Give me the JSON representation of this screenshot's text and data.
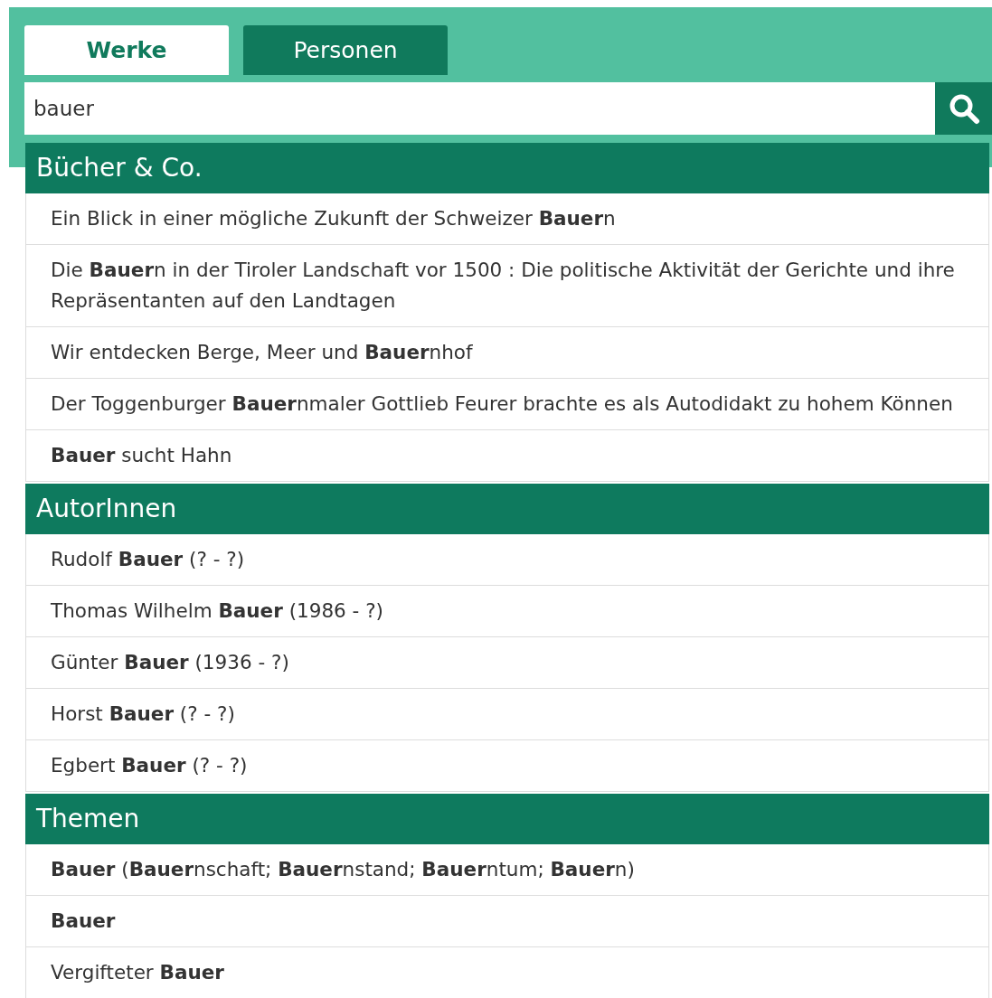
{
  "tabs": [
    {
      "label": "Werke",
      "selected": true
    },
    {
      "label": "Personen",
      "selected": false
    }
  ],
  "search": {
    "value": "bauer"
  },
  "sections": [
    {
      "title": "Bücher & Co.",
      "items": [
        "Ein Blick in einer mögliche Zukunft der Schweizer **Bauer**n",
        "Die **Bauer**n in der Tiroler Landschaft vor 1500 : Die politische Aktivität der Gerichte und ihre Repräsentanten auf den Landtagen",
        "Wir entdecken Berge, Meer und **Bauer**nhof",
        "Der Toggenburger **Bauer**nmaler Gottlieb Feurer brachte es als Autodidakt zu hohem Können",
        "**Bauer** sucht Hahn"
      ]
    },
    {
      "title": "AutorInnen",
      "items": [
        "Rudolf **Bauer** (? - ?)",
        "Thomas Wilhelm **Bauer** (1986 - ?)",
        "Günter **Bauer** (1936 - ?)",
        "Horst **Bauer** (? - ?)",
        "Egbert **Bauer** (? - ?)"
      ]
    },
    {
      "title": "Themen",
      "items": [
        "**Bauer** (**Bauer**nschaft; **Bauer**nstand; **Bauer**ntum; **Bauer**n)",
        "**Bauer**",
        "Vergifteter **Bauer**"
      ]
    }
  ]
}
